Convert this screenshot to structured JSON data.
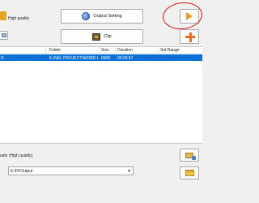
{
  "top": {
    "quality_label": "High quality",
    "output_setting_label": "Output Setting",
    "clip_label": "Clip"
  },
  "file_list": {
    "columns": [
      "Folder",
      "Size",
      "Duration",
      "Set Range"
    ],
    "rows": [
      {
        "name": "D",
        "folder": "E:\\NEL PROJECT\\WORD P...",
        "size": "690K",
        "duration": "00:00:57",
        "set_range": ""
      }
    ]
  },
  "bottom": {
    "profile_label": "aste (High quality)",
    "output_path": "E:\\FFOutput"
  },
  "colors": {
    "selection": "#0a6fd6",
    "annotation": "#e01818",
    "start_arrow": "#f29a1e",
    "add_plus": "#f36b1f"
  },
  "icons": {
    "output_setting": "output-setting-icon",
    "clip": "clip-icon",
    "start": "start-arrow-icon",
    "add": "add-plus-icon",
    "browse": "folder-icon"
  }
}
